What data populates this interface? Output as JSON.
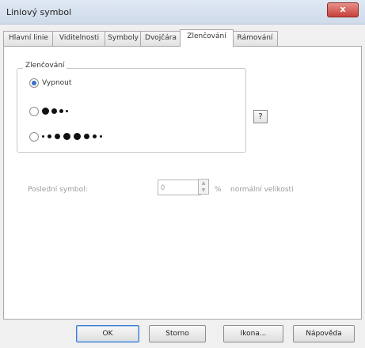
{
  "window": {
    "title": "Liniový symbol",
    "close_label": "x"
  },
  "tabs": [
    {
      "label": "Hlavní linie"
    },
    {
      "label": "Viditelnosti"
    },
    {
      "label": "Symboly"
    },
    {
      "label": "Dvojčára"
    },
    {
      "label": "Zlenčování"
    },
    {
      "label": "Rámování"
    }
  ],
  "active_tab": "Zlenčování",
  "group": {
    "label": "Zlenčování",
    "help_label": "?"
  },
  "options": [
    {
      "label": "Vypnout",
      "selected": true
    },
    {
      "label": "",
      "selected": false
    },
    {
      "label": "",
      "selected": false
    }
  ],
  "last_symbol": {
    "label": "Poslední symbol:",
    "value": "0",
    "unit": "%",
    "suffix": "normální velikosti"
  },
  "buttons": {
    "ok": "OK",
    "cancel": "Storno",
    "icon": "Ikona...",
    "help": "Nápověda"
  },
  "colors": {
    "accent": "#3a6fc4",
    "close": "#c8413a"
  }
}
